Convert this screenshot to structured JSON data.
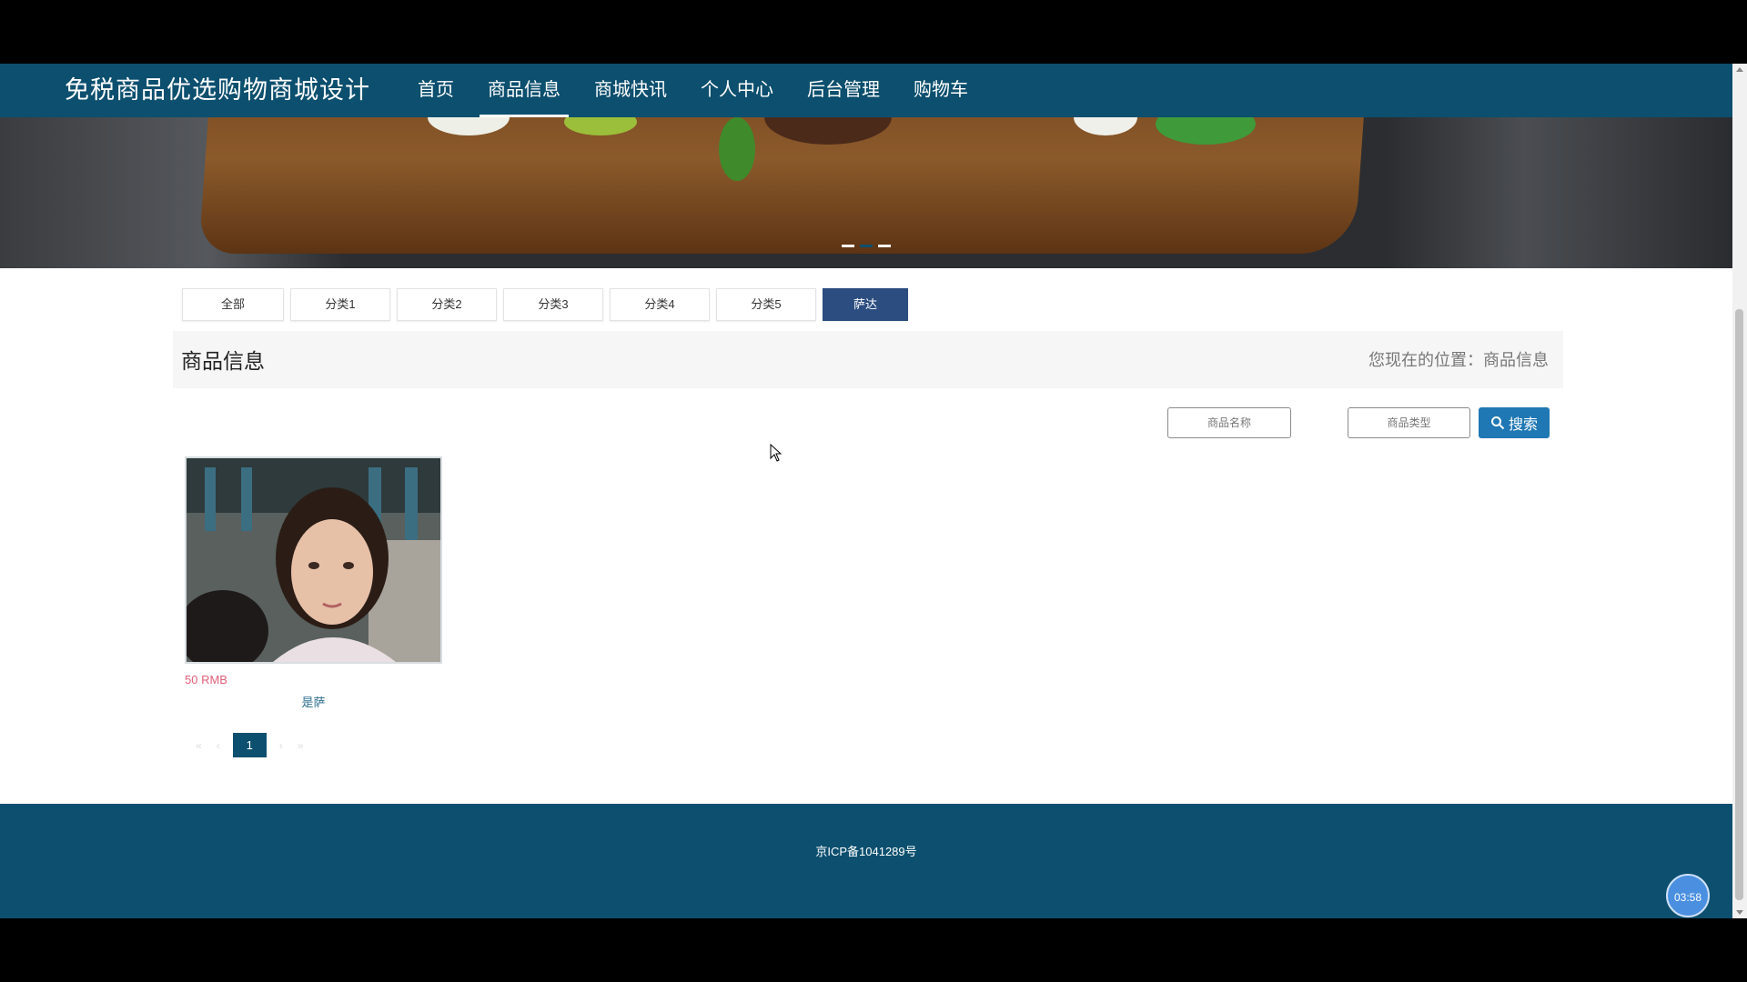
{
  "header": {
    "site_title": "免税商品优选购物商城设计",
    "nav": [
      {
        "label": "首页",
        "active": false
      },
      {
        "label": "商品信息",
        "active": true
      },
      {
        "label": "商城快讯",
        "active": false
      },
      {
        "label": "个人中心",
        "active": false
      },
      {
        "label": "后台管理",
        "active": false
      },
      {
        "label": "购物车",
        "active": false
      }
    ]
  },
  "banner": {
    "active_slide": 2,
    "slide_count": 3
  },
  "categories": {
    "tabs": [
      {
        "label": "全部",
        "active": false
      },
      {
        "label": "分类1",
        "active": false
      },
      {
        "label": "分类2",
        "active": false
      },
      {
        "label": "分类3",
        "active": false
      },
      {
        "label": "分类4",
        "active": false
      },
      {
        "label": "分类5",
        "active": false
      },
      {
        "label": "萨达",
        "active": true
      }
    ]
  },
  "section": {
    "title": "商品信息",
    "breadcrumb": "您现在的位置：商品信息"
  },
  "search": {
    "name_placeholder": "商品名称",
    "type_placeholder": "商品类型",
    "button_label": "搜索"
  },
  "products": [
    {
      "price": "50 RMB",
      "name": "是萨"
    }
  ],
  "pagination": {
    "prev": "«",
    "prev_small": "‹",
    "current": "1",
    "next": "›",
    "last": "»"
  },
  "footer": {
    "icp": "京ICP备1041289号"
  },
  "timer": {
    "value": "03:58"
  },
  "colors": {
    "primary": "#0c4f6e",
    "active_tab": "#2b4d80",
    "search_button": "#1f78b4",
    "price": "#e06078"
  }
}
